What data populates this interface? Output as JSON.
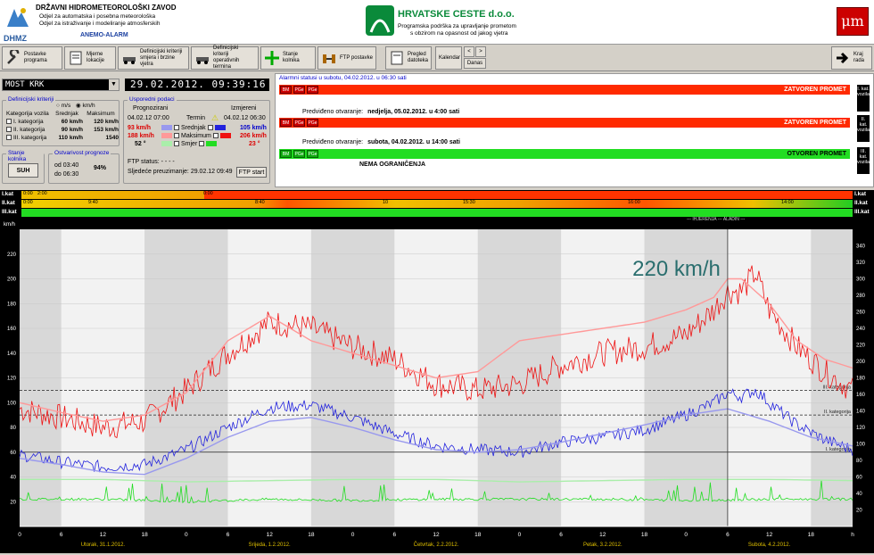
{
  "header": {
    "org_title": "DRŽAVNI HIDROMETEOROLOŠKI ZAVOD",
    "org_line1": "Odjel za automatska i posebna meteorološka",
    "org_line2": "Odjel za istraživanje i modeliranje atmosferskih",
    "logo_text": "DHMZ",
    "system_name": "ANEMO-ALARM",
    "company": "HRVATSKE CESTE d.o.o.",
    "company_sub1": "Programska podrška za upravljanje prometom",
    "company_sub2": "s obzirom na opasnost od jakog vjetra",
    "right_logo": "μm"
  },
  "toolbar": {
    "settings": "Postavke programa",
    "locations": "Mjerne lokacije",
    "criteria_dir": "Definicijski kriteriji smjera i brzine vjetra",
    "criteria_op": "Definicijski kriteriji operativnih termina",
    "road_state": "Stanje kolnika",
    "ftp": "FTP postavke",
    "files": "Pregled datoteka",
    "calendar": "Kalendar",
    "prev": "<",
    "next": ">",
    "today": "Danas",
    "exit": "Kraj rada"
  },
  "location": {
    "name": "MOST KRK",
    "datetime": "29.02.2012. 09:39:16"
  },
  "criteria": {
    "title": "Definicijski kriteriji",
    "radio_ms": "m/s",
    "radio_kmh": "km/h",
    "col_cat": "Kategorija vozila",
    "col_avg": "Srednjak",
    "col_max": "Maksimum",
    "rows": [
      {
        "cat": "I. kategorija",
        "avg": "60 km/h",
        "max": "120 km/h"
      },
      {
        "cat": "II. kategorija",
        "avg": "90 km/h",
        "max": "153 km/h"
      },
      {
        "cat": "III. kategorija",
        "avg": "110 km/h",
        "max": "1540"
      }
    ]
  },
  "compare": {
    "title": "Usporedni podaci",
    "forecast_hdr": "Prognozirani",
    "term_hdr": "Termin",
    "measured_hdr": "Izmjereni",
    "forecast_time": "04.02.12 07:00",
    "measured_time": "04.02.12 06:30",
    "f_avg": "93 km/h",
    "f_max": "188 km/h",
    "f_dir": "52 °",
    "lbl_avg": "Srednjak",
    "lbl_max": "Maksimum",
    "lbl_dir": "Smjer",
    "m_avg": "105 km/h",
    "m_max": "206 km/h",
    "m_dir": "23 °",
    "ftp_status": "FTP status: - - - -",
    "next_transfer": "Sljedeće preuzimanje: 29.02.12 09:49",
    "ftp_start": "FTP start"
  },
  "road": {
    "title": "Stanje kolnika",
    "value": "SUH"
  },
  "reliability": {
    "title": "Ostvarivost prognoze",
    "from": "od 03:40",
    "to": "do 06:30",
    "value": "94%"
  },
  "alarms": {
    "title": "Alarmni statusi u subotu, 04.02.2012. u 06:30 sati",
    "kat1": {
      "status": "ZATVOREN PROMET",
      "label": "I. kat. vozila",
      "color": "#ff2a00"
    },
    "kat1_open_lbl": "Predviđeno otvaranje:",
    "kat1_open": "nedjelja, 05.02.2012. u 4:00 sati",
    "kat2": {
      "status": "ZATVOREN PROMET",
      "label": "II. kat. vozila",
      "color": "#ff2a00"
    },
    "kat2_open_lbl": "Predviđeno otvaranje:",
    "kat2_open": "subota, 04.02.2012. u 14:00 sati",
    "kat3": {
      "status": "OTVOREN PROMET",
      "label": "III. kat. vozila",
      "color": "#22dd22"
    },
    "kat3_note": "NEMA OGRANIČENJA",
    "pills": [
      "BM",
      "PGe",
      "PGe"
    ]
  },
  "strips": {
    "labels": [
      "I.kat",
      "II.kat",
      "III.kat"
    ],
    "kat1_times": [
      "0:00",
      "2:00",
      "0:00"
    ],
    "kat2_times": [
      "0:00",
      "9:40",
      "8:40",
      "10",
      "15:30",
      "16:00",
      "14:00"
    ],
    "marker": "--- IHJERENJA ---  ALADIN ---"
  },
  "chart_data": {
    "type": "line",
    "title": "",
    "overlay_label": "220 km/h",
    "ylabel": "km/h",
    "ylim": [
      0,
      240
    ],
    "yticks": [
      20,
      40,
      60,
      80,
      100,
      120,
      140,
      160,
      180,
      200,
      220
    ],
    "ylim_right": [
      0,
      360
    ],
    "yticks_right": [
      20,
      40,
      60,
      80,
      100,
      120,
      140,
      160,
      180,
      200,
      220,
      240,
      260,
      280,
      300,
      320,
      340
    ],
    "x_hours": [
      "0",
      "6",
      "12",
      "18",
      "0",
      "6",
      "12",
      "18",
      "0",
      "6",
      "12",
      "18",
      "0",
      "6",
      "12",
      "18",
      "0",
      "6",
      "12",
      "18",
      "h"
    ],
    "days": [
      "Utorak, 31.1.2012.",
      "Srijeda, 1.2.2012.",
      "Četvrtak, 2.2.2012.",
      "Petak, 3.2.2012.",
      "Subota, 4.2.2012."
    ],
    "thresholds": [
      {
        "name": "III. kategorija",
        "value": 110
      },
      {
        "name": "II. kategorija",
        "value": 90
      },
      {
        "name": "I. kategorija",
        "value": 60
      }
    ],
    "x_range": [
      0,
      120
    ],
    "now_hour": 102,
    "series": [
      {
        "name": "Maksimum izmjereni",
        "color": "#ee1111",
        "x": [
          0,
          6,
          12,
          18,
          24,
          30,
          36,
          42,
          48,
          54,
          60,
          66,
          72,
          78,
          84,
          90,
          96,
          100,
          102,
          104,
          106,
          108,
          112,
          116,
          120
        ],
        "values": [
          95,
          88,
          80,
          85,
          110,
          140,
          165,
          160,
          145,
          135,
          115,
          110,
          115,
          130,
          140,
          145,
          155,
          175,
          190,
          190,
          205,
          175,
          145,
          125,
          110
        ]
      },
      {
        "name": "Maksimum prognozirani",
        "color": "#ff9999",
        "x": [
          0,
          6,
          12,
          18,
          24,
          30,
          36,
          42,
          48,
          54,
          60,
          66,
          72,
          78,
          84,
          90,
          96,
          100,
          102,
          104,
          108,
          112,
          116,
          120
        ],
        "values": [
          100,
          92,
          85,
          90,
          108,
          150,
          170,
          150,
          140,
          130,
          120,
          125,
          150,
          155,
          160,
          165,
          175,
          185,
          200,
          200,
          180,
          150,
          135,
          128
        ]
      },
      {
        "name": "Srednjak izmjereni",
        "color": "#2222dd",
        "x": [
          0,
          6,
          12,
          18,
          24,
          30,
          36,
          42,
          48,
          54,
          60,
          66,
          72,
          78,
          84,
          90,
          96,
          100,
          102,
          104,
          106,
          108,
          112,
          116,
          120
        ],
        "values": [
          58,
          52,
          48,
          50,
          62,
          80,
          96,
          98,
          88,
          75,
          65,
          62,
          60,
          68,
          72,
          78,
          90,
          100,
          108,
          105,
          110,
          100,
          82,
          70,
          62
        ]
      },
      {
        "name": "Srednjak prognozirani",
        "color": "#9999ee",
        "x": [
          0,
          6,
          12,
          18,
          24,
          30,
          36,
          42,
          48,
          54,
          60,
          66,
          72,
          78,
          84,
          90,
          96,
          102,
          108,
          114,
          120
        ],
        "values": [
          55,
          50,
          44,
          42,
          55,
          72,
          85,
          88,
          80,
          70,
          62,
          60,
          62,
          68,
          75,
          82,
          90,
          95,
          85,
          72,
          65
        ]
      },
      {
        "name": "Smjer",
        "color": "#22dd22",
        "x": [
          0,
          12,
          24,
          36,
          48,
          60,
          72,
          84,
          96,
          108,
          120
        ],
        "values": [
          22,
          22,
          20,
          22,
          21,
          22,
          22,
          22,
          21,
          22,
          22
        ]
      },
      {
        "name": "Smjer prognozirani",
        "color": "#aaeeaa",
        "x": [
          0,
          12,
          24,
          36,
          48,
          60,
          72,
          84,
          96,
          108,
          120
        ],
        "values": [
          38,
          38,
          36,
          37,
          38,
          38,
          36,
          37,
          38,
          38,
          37
        ]
      }
    ]
  }
}
